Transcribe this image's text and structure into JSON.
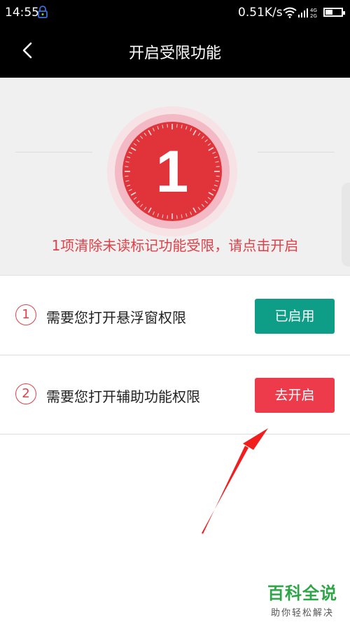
{
  "status_bar": {
    "time": "14:55",
    "net_speed": "0.51K/s",
    "signal_labels": [
      "4G",
      "2G"
    ]
  },
  "header": {
    "title": "开启受限功能"
  },
  "summary": {
    "count": "1",
    "message": "1项清除未读标记功能受限，请点击开启"
  },
  "permissions": [
    {
      "number": "1",
      "label": "需要您打开悬浮窗权限",
      "button": "已启用",
      "state": "enabled"
    },
    {
      "number": "2",
      "label": "需要您打开辅助功能权限",
      "button": "去开启",
      "state": "disabled"
    }
  ],
  "colors": {
    "accent_red": "#e04047",
    "enabled_green": "#0e9d86",
    "action_red": "#ee3b4c"
  },
  "watermark": {
    "title": "百科全说",
    "subtitle": "助你轻松解决"
  }
}
